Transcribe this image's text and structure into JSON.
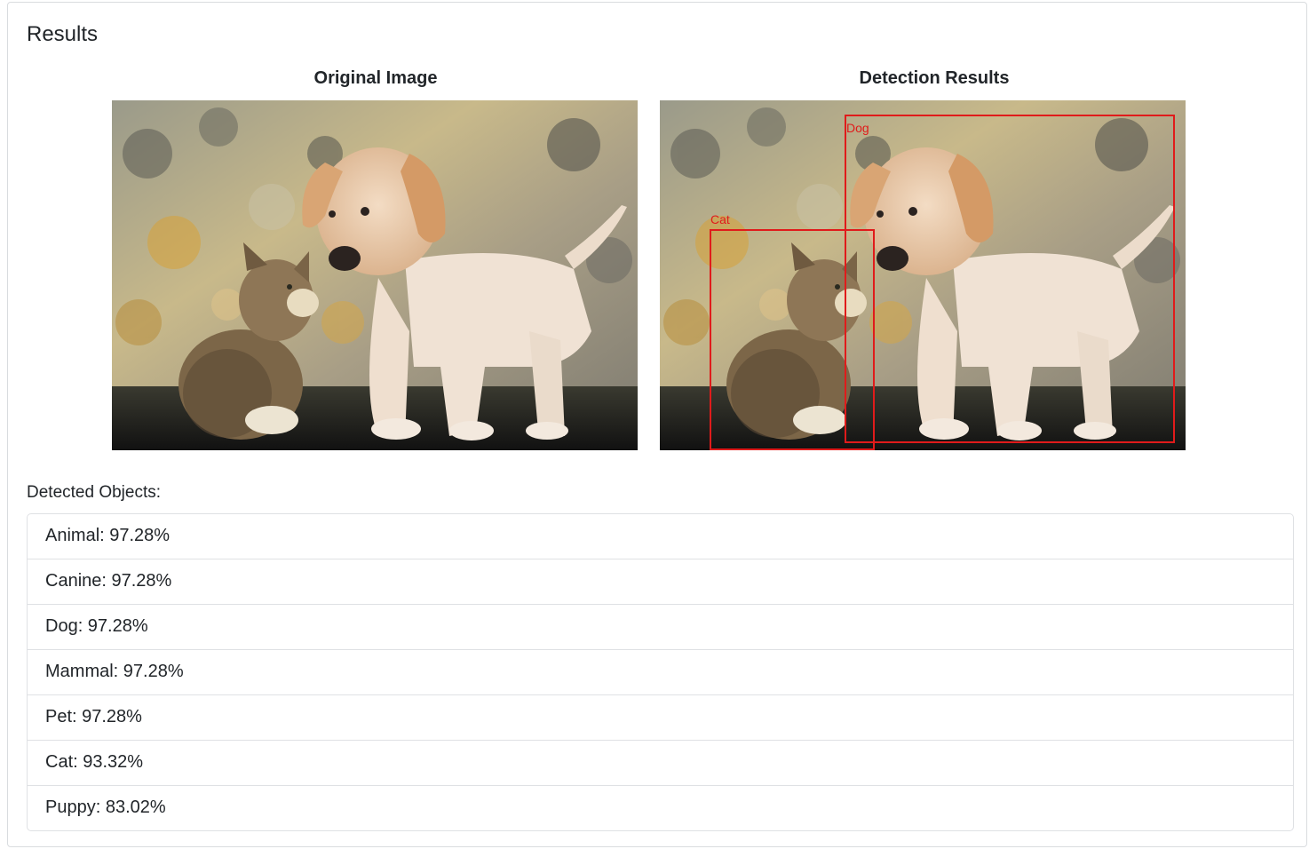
{
  "card": {
    "title": "Results"
  },
  "original": {
    "heading": "Original Image"
  },
  "detection": {
    "heading": "Detection Results",
    "box_color": "#e01b1b",
    "boxes": [
      {
        "label": "Dog"
      },
      {
        "label": "Cat"
      }
    ]
  },
  "detected": {
    "heading": "Detected Objects:",
    "items": [
      {
        "text": "Animal: 97.28%"
      },
      {
        "text": "Canine: 97.28%"
      },
      {
        "text": "Dog: 97.28%"
      },
      {
        "text": "Mammal: 97.28%"
      },
      {
        "text": "Pet: 97.28%"
      },
      {
        "text": "Cat: 93.32%"
      },
      {
        "text": "Puppy: 83.02%"
      }
    ]
  }
}
